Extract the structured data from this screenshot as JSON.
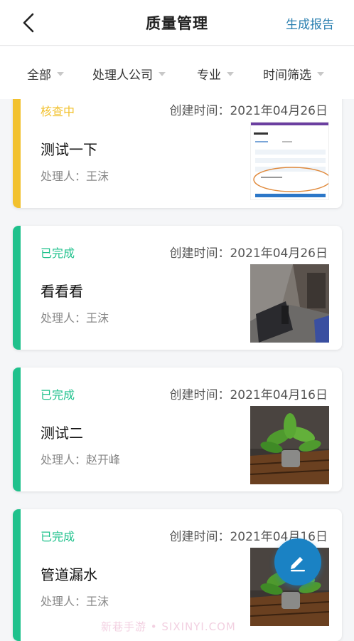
{
  "header": {
    "title": "质量管理",
    "action_label": "生成报告"
  },
  "filters": [
    {
      "label": "全部"
    },
    {
      "label": "处理人公司"
    },
    {
      "label": "专业"
    },
    {
      "label": "时间筛选"
    }
  ],
  "records": [
    {
      "status": "核查中",
      "status_color": "#f2c12e",
      "created": "创建时间：2021年04月26日",
      "title": "测试一下",
      "handler": "处理人：王沫",
      "thumbnail": "form-screenshot"
    },
    {
      "status": "已完成",
      "status_color": "#1fc18c",
      "created": "创建时间：2021年04月26日",
      "title": "看看看",
      "handler": "处理人：王沫",
      "thumbnail": "office-photo"
    },
    {
      "status": "已完成",
      "status_color": "#1fc18c",
      "created": "创建时间：2021年04月16日",
      "title": "测试二",
      "handler": "处理人：赵开峰",
      "thumbnail": "plant-photo"
    },
    {
      "status": "已完成",
      "status_color": "#1fc18c",
      "created": "创建时间：2021年04月16日",
      "title": "管道漏水",
      "handler": "处理人：王沫",
      "thumbnail": "plant-photo"
    }
  ],
  "fab": {
    "icon": "pencil-icon"
  },
  "watermark": "新巷手游 • SIXINYI.COM",
  "colors": {
    "accent": "#1a82c4",
    "link": "#2a7fb0",
    "in_progress": "#f2c12e",
    "done": "#1fc18c"
  }
}
